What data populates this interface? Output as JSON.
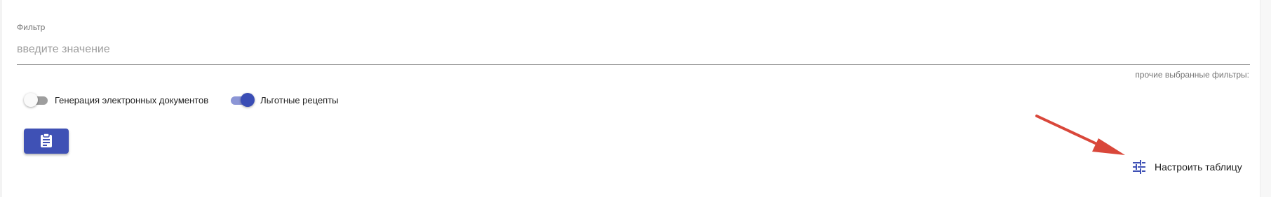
{
  "filter": {
    "label": "Фильтр",
    "placeholder": "введите значение",
    "value": ""
  },
  "other_filters_label": "прочие выбранные фильтры:",
  "toggles": [
    {
      "label": "Генерация электронных документов",
      "state": "off"
    },
    {
      "label": "Льготные рецепты",
      "state": "on"
    }
  ],
  "clipboard_button": {
    "icon": "clipboard-icon",
    "color": "#3f51b5"
  },
  "configure_table": {
    "label": "Настроить таблицу",
    "icon": "tune-icon",
    "icon_color": "#3f51b5"
  },
  "annotation": {
    "type": "arrow",
    "color": "#d9473a"
  }
}
